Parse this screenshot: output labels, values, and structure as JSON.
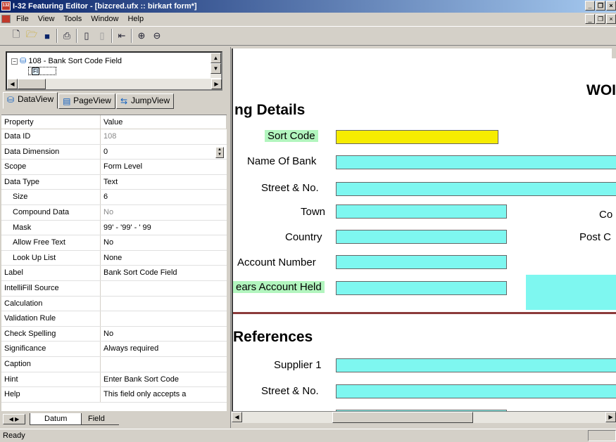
{
  "window": {
    "title": "I-32 Featuring Editor - [bizcred.ufx :: birkart form*]",
    "app_icon": "i32-app-icon"
  },
  "menu": {
    "items": [
      "File",
      "View",
      "Tools",
      "Window",
      "Help"
    ]
  },
  "toolbar": {
    "icons": [
      "new-icon",
      "open-icon",
      "save-icon",
      "print-icon",
      "page-icon",
      "page-next-icon",
      "jump-icon",
      "zoom-in-icon",
      "zoom-out-icon"
    ]
  },
  "tree": {
    "root_label": "108 - Bank Sort Code Field",
    "child_label": "FI"
  },
  "view_tabs": [
    {
      "label": "DataView",
      "icon": "datum-icon"
    },
    {
      "label": "PageView",
      "icon": "page-icon"
    },
    {
      "label": "JumpView",
      "icon": "jump-icon"
    }
  ],
  "properties": {
    "header": {
      "name": "Property",
      "value": "Value"
    },
    "rows": [
      {
        "name": "Data ID",
        "value": "108"
      },
      {
        "name": "Data Dimension",
        "value": "0"
      },
      {
        "name": "Scope",
        "value": "Form Level"
      },
      {
        "name": "Data Type",
        "value": "Text"
      },
      {
        "name": "Size",
        "value": "6"
      },
      {
        "name": "Compound Data",
        "value": "No"
      },
      {
        "name": "Mask",
        "value": "99' - '99' - ' 99"
      },
      {
        "name": "Allow Free Text",
        "value": "No"
      },
      {
        "name": "Look Up List",
        "value": "None"
      },
      {
        "name": "Label",
        "value": "Bank Sort Code Field"
      },
      {
        "name": "IntelliFill Source",
        "value": ""
      },
      {
        "name": "Calculation",
        "value": ""
      },
      {
        "name": "Validation Rule",
        "value": ""
      },
      {
        "name": "Check Spelling",
        "value": "No"
      },
      {
        "name": "Significance",
        "value": "Always required"
      },
      {
        "name": "Caption",
        "value": ""
      },
      {
        "name": "Hint",
        "value": "Enter Bank Sort Code"
      },
      {
        "name": "Help",
        "value": "This field only accepts a"
      }
    ]
  },
  "bottom_tabs": [
    "Datum",
    "Field"
  ],
  "form": {
    "heading_top": "WOI",
    "section1": "ng Details",
    "section2": "References",
    "labels": {
      "sort_code": "Sort Code",
      "name_of_bank": "Name Of Bank",
      "street1": "Street & No.",
      "town": "Town",
      "country": "Country",
      "account_number": "Account Number",
      "years_held": "ears Account Held",
      "supplier1": "Supplier 1",
      "street2": "Street & No.",
      "co": "Co",
      "post": "Post C"
    }
  },
  "status": {
    "text": "Ready"
  }
}
